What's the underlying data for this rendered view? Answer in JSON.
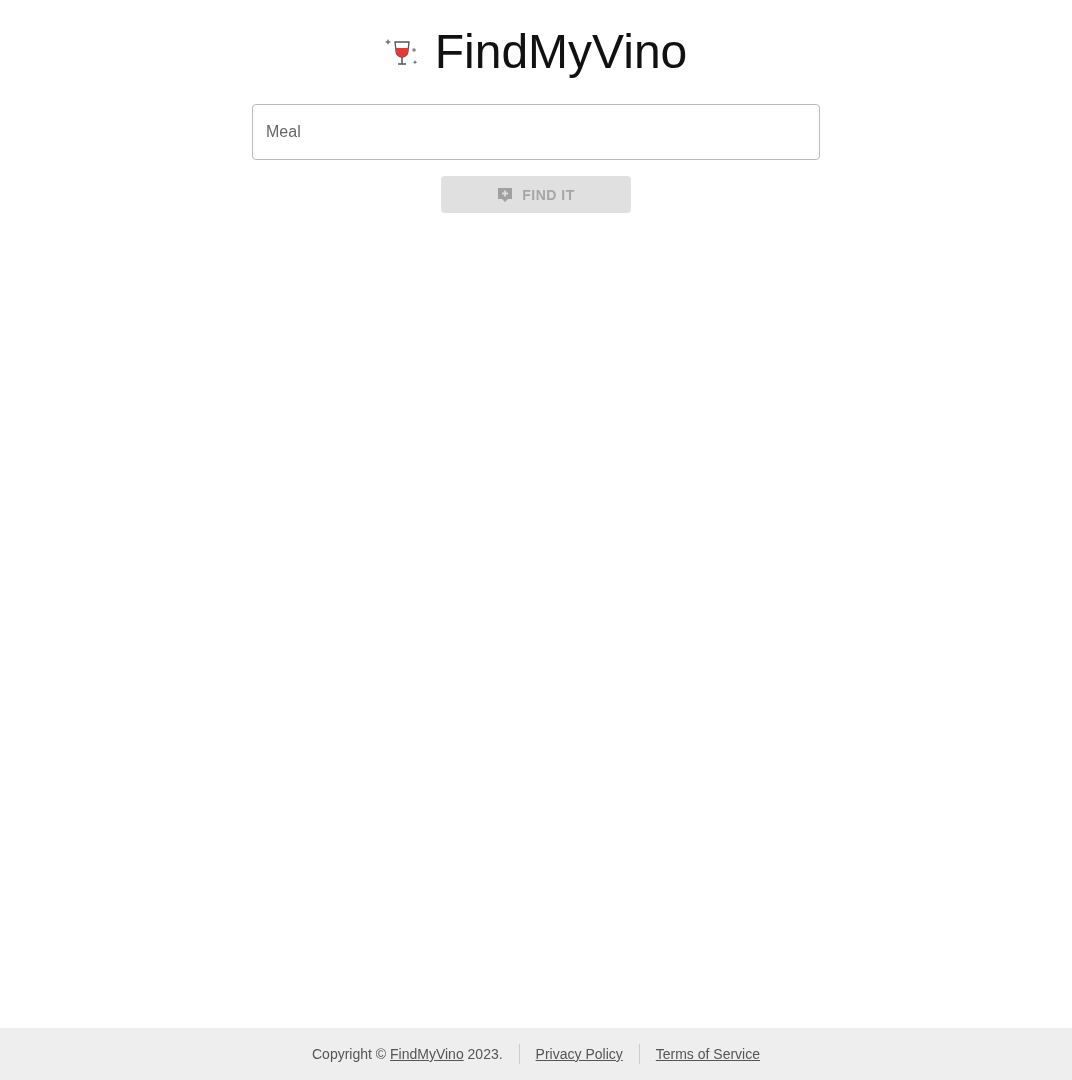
{
  "header": {
    "title": "FindMyVino"
  },
  "meal_field": {
    "placeholder": "Meal"
  },
  "find_button": {
    "label": "FIND IT",
    "disabled": true
  },
  "footer": {
    "copyright": {
      "prefix": "Copyright ©",
      "link": "FindMyVino",
      "suffix": "2023."
    },
    "links": [
      "Privacy Policy",
      "Terms of Service"
    ]
  }
}
